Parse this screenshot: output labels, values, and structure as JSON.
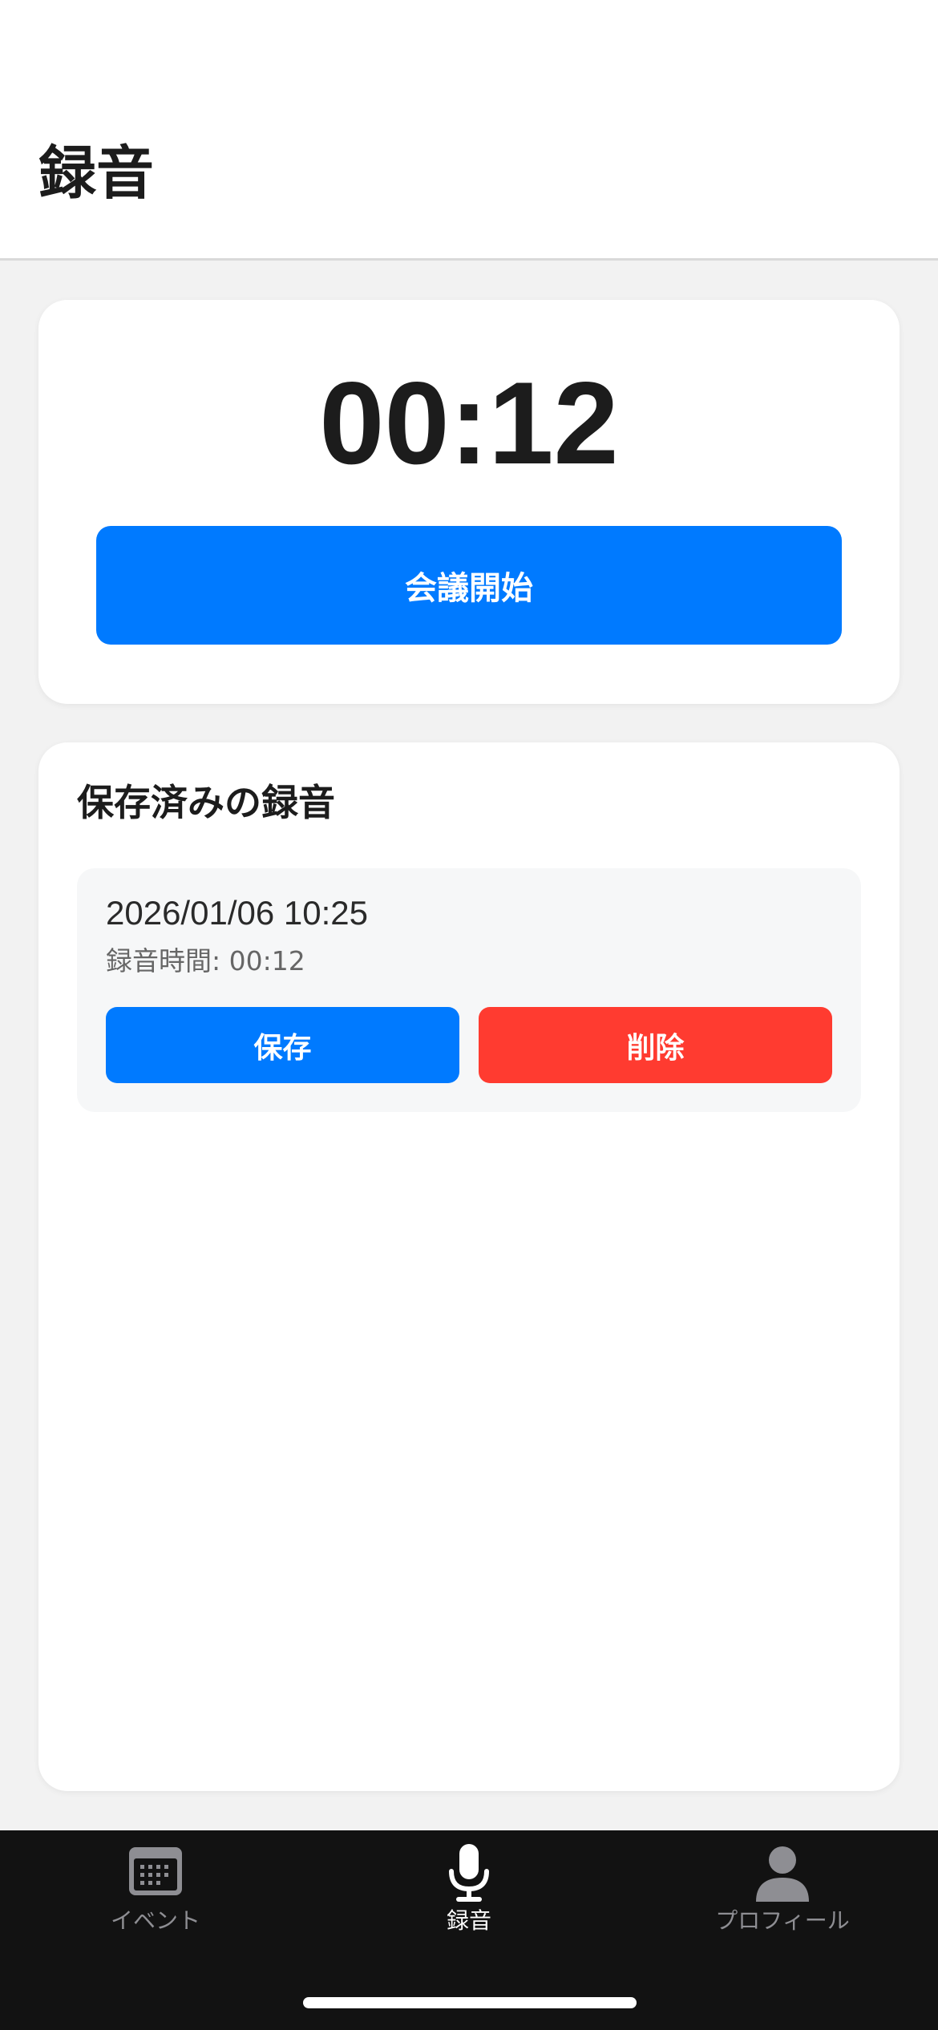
{
  "header": {
    "title": "録音"
  },
  "timer_card": {
    "elapsed": "00:12",
    "start_label": "会議開始"
  },
  "saved": {
    "section_title": "保存済みの録音",
    "items": [
      {
        "datetime": "2026/01/06 10:25",
        "duration_text": "録音時間: 00:12",
        "save_label": "保存",
        "delete_label": "削除"
      }
    ]
  },
  "tabbar": {
    "tabs": [
      {
        "label": "イベント",
        "icon": "calendar-icon",
        "active": false
      },
      {
        "label": "録音",
        "icon": "microphone-icon",
        "active": true
      },
      {
        "label": "プロフィール",
        "icon": "person-icon",
        "active": false
      }
    ]
  },
  "colors": {
    "primary": "#007aff",
    "danger": "#ff3b30",
    "tabbar_bg": "#121212"
  }
}
